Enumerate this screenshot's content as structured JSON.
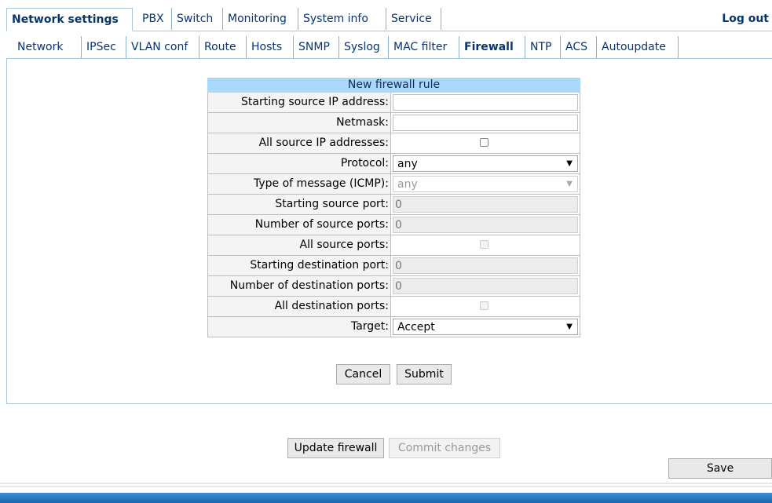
{
  "topnav": {
    "tabs": [
      {
        "label": "Network settings"
      },
      {
        "label": "PBX"
      },
      {
        "label": "Switch"
      },
      {
        "label": "Monitoring"
      },
      {
        "label": "System info"
      },
      {
        "label": "Service"
      }
    ],
    "logout": "Log out"
  },
  "subnav": {
    "tabs": [
      {
        "label": "Network"
      },
      {
        "label": "IPSec"
      },
      {
        "label": "VLAN conf"
      },
      {
        "label": "Route"
      },
      {
        "label": "Hosts"
      },
      {
        "label": "SNMP"
      },
      {
        "label": "Syslog"
      },
      {
        "label": "MAC filter"
      },
      {
        "label": "Firewall"
      },
      {
        "label": "NTP"
      },
      {
        "label": "ACS"
      },
      {
        "label": "Autoupdate"
      }
    ]
  },
  "form": {
    "title": "New firewall rule",
    "fields": {
      "start_src_ip": {
        "label": "Starting source IP address:",
        "value": ""
      },
      "netmask": {
        "label": "Netmask:",
        "value": ""
      },
      "all_src_ip": {
        "label": "All source IP addresses:"
      },
      "protocol": {
        "label": "Protocol:",
        "value": "any"
      },
      "icmp_type": {
        "label": "Type of message (ICMP):",
        "value": "any"
      },
      "start_src_port": {
        "label": "Starting source port:",
        "value": "0"
      },
      "num_src_ports": {
        "label": "Number of source ports:",
        "value": "0"
      },
      "all_src_ports": {
        "label": "All source ports:"
      },
      "start_dst_port": {
        "label": "Starting destination port:",
        "value": "0"
      },
      "num_dst_ports": {
        "label": "Number of destination ports:",
        "value": "0"
      },
      "all_dst_ports": {
        "label": "All destination ports:"
      },
      "target": {
        "label": "Target:",
        "value": "Accept"
      }
    },
    "cancel": "Cancel",
    "submit": "Submit"
  },
  "actions": {
    "update_firewall": "Update firewall",
    "commit_changes": "Commit changes",
    "save": "Save"
  },
  "colors": {
    "form_title_bg": "#a9d8f8",
    "nav_text": "#0a3470",
    "footer_bar": "#1b66b0"
  }
}
